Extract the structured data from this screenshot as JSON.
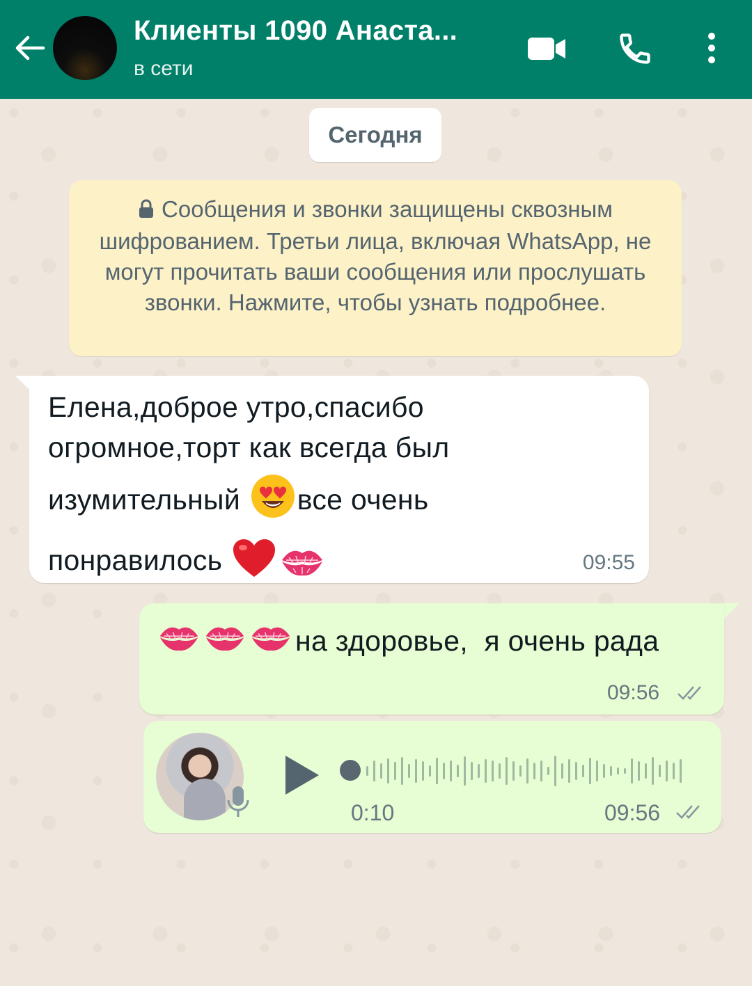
{
  "header": {
    "title": "Клиенты 1090 Анаста...",
    "status": "в сети",
    "icons": [
      "back-arrow-icon",
      "video-call-icon",
      "phone-icon",
      "more-vert-icon"
    ],
    "color": "#008069"
  },
  "chat": {
    "date_chip": "Сегодня",
    "encryption_notice": "Сообщения и звонки защищены сквозным шифрованием. Третьи лица, включая WhatsApp, не могут прочитать ваши сообщения или прослушать звонки. Нажмите, чтобы узнать подробнее.",
    "messages": [
      {
        "direction": "incoming",
        "lines": [
          "Елена,доброе утро,спасибо",
          "огромное,торт как всегда был",
          "изумительный",
          "все очень",
          "понравилось"
        ],
        "emojis": [
          "heart-eyes-emoji",
          "red-heart-emoji",
          "kiss-mark-emoji"
        ],
        "time": "09:55"
      },
      {
        "direction": "outgoing",
        "text": "на здоровье,  я очень рада",
        "emojis": [
          "kiss-mark-emoji",
          "kiss-mark-emoji",
          "kiss-mark-emoji"
        ],
        "time": "09:56",
        "status": "read"
      },
      {
        "direction": "outgoing",
        "type": "voice",
        "duration": "0:10",
        "time": "09:56",
        "status": "read"
      }
    ]
  },
  "colors": {
    "incoming_bubble": "#ffffff",
    "outgoing_bubble": "#e7fdd3",
    "notice_bg": "#fdf1c8",
    "chat_bg": "#efe7dd"
  }
}
